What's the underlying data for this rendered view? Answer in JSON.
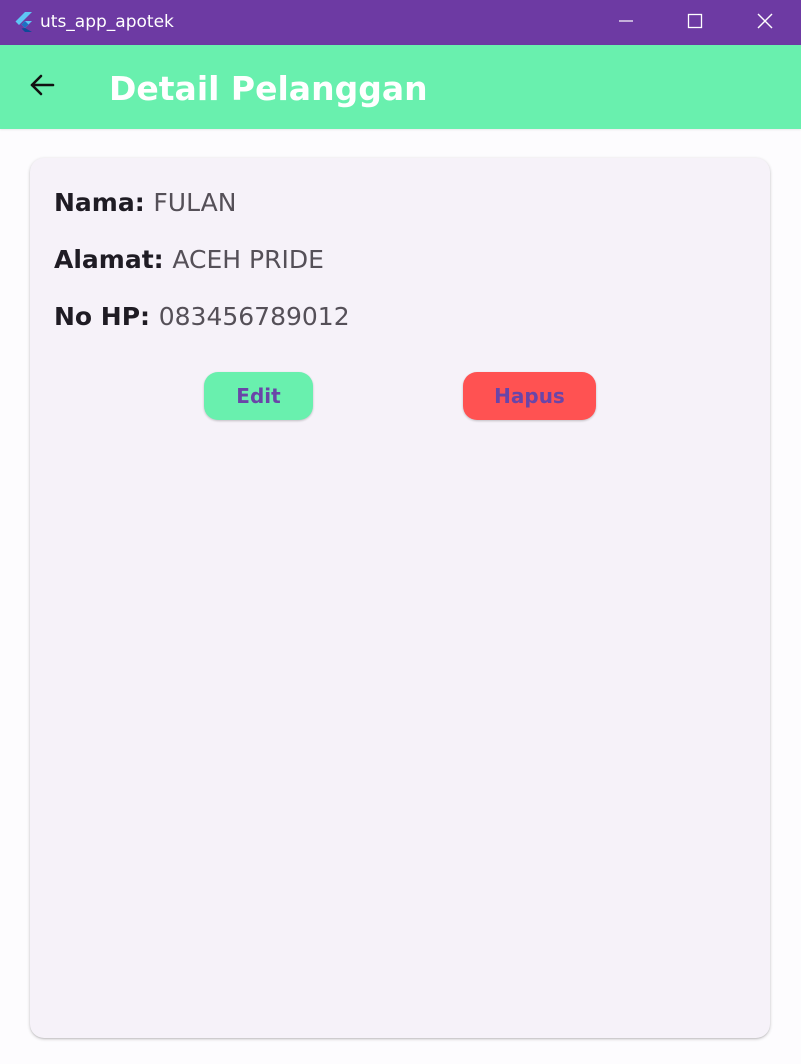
{
  "window": {
    "title": "uts_app_apotek",
    "title_bar_color": "#6d3aa3",
    "icons": {
      "app": "flutter-logo-icon",
      "minimize": "minimize-icon",
      "maximize": "maximize-icon",
      "close": "close-icon"
    }
  },
  "appbar": {
    "title": "Detail Pelanggan",
    "back_icon": "arrow-left-icon",
    "background": "#69f0ae"
  },
  "customer": {
    "nama_label": "Nama:",
    "nama_value": "FULAN",
    "alamat_label": "Alamat:",
    "alamat_value": "ACEH PRIDE",
    "nohp_label": "No HP:",
    "nohp_value": "083456789012"
  },
  "actions": {
    "edit_label": "Edit",
    "edit_color": "#69f0ae",
    "hapus_label": "Hapus",
    "hapus_color": "#ff5252"
  }
}
